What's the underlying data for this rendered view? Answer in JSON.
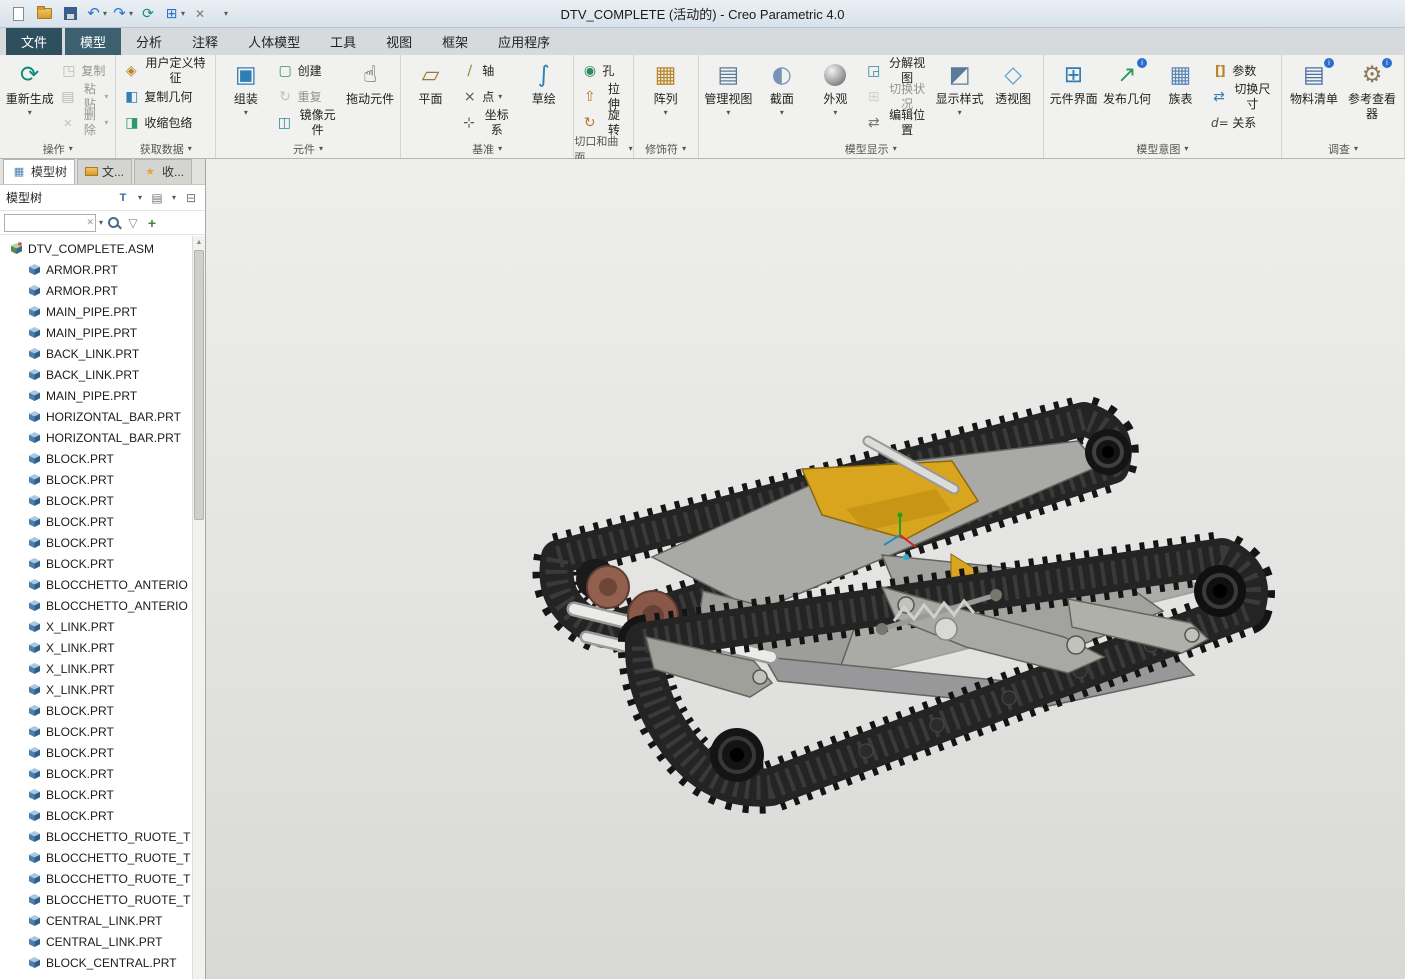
{
  "window": {
    "title": "DTV_COMPLETE (活动的) - Creo Parametric 4.0"
  },
  "quick_access": {
    "icons": [
      "new-file",
      "open",
      "save",
      "undo",
      "redo",
      "regenerate",
      "windows",
      "close-window",
      "customize"
    ]
  },
  "ribbon": {
    "tabs": [
      "文件",
      "模型",
      "分析",
      "注释",
      "人体模型",
      "工具",
      "视图",
      "框架",
      "应用程序"
    ],
    "active_tab": "模型",
    "groups": {
      "operations": {
        "label": "操作",
        "buttons": {
          "regenerate": "重新生成",
          "copy": "复制",
          "paste": "粘贴",
          "delete": "删除"
        }
      },
      "get_data": {
        "label": "获取数据",
        "buttons": {
          "udf": "用户定义特征",
          "copy_geometry": "复制几何",
          "shrinkwrap": "收缩包络"
        }
      },
      "component": {
        "label": "元件",
        "buttons": {
          "assemble": "组装",
          "create": "创建",
          "repeat": "重复",
          "mirror": "镜像元件",
          "drag": "拖动元件"
        }
      },
      "datum": {
        "label": "基准",
        "buttons": {
          "plane": "平面",
          "axis": "轴",
          "point": "点",
          "csys": "坐标系",
          "sketch": "草绘"
        }
      },
      "cut_surface": {
        "label": "切口和曲面",
        "buttons": {
          "hole": "孔",
          "extrude": "拉伸",
          "revolve": "旋转"
        }
      },
      "modifiers": {
        "label": "修饰符",
        "buttons": {
          "pattern": "阵列"
        }
      },
      "model_display": {
        "label": "模型显示",
        "buttons": {
          "manage_views": "管理视图",
          "section": "截面",
          "appearance": "外观",
          "exploded_view": "分解视图",
          "switch_state": "切换状况",
          "edit_position": "编辑位置",
          "display_style": "显示样式",
          "perspective": "透视图"
        }
      },
      "model_intent": {
        "label": "模型意图",
        "buttons": {
          "component_interface": "元件界面",
          "publish_geometry": "发布几何",
          "family_table": "族表",
          "parameters": "参数",
          "switch_dimensions": "切换尺寸",
          "relations": "关系"
        }
      },
      "investigate": {
        "label": "调查",
        "buttons": {
          "bom": "物料清单",
          "reference_viewer": "参考查看器"
        }
      }
    }
  },
  "tree_panel": {
    "tabs": [
      "模型树",
      "文...",
      "收..."
    ],
    "header": "模型树",
    "toolbar_icons": [
      "filter",
      "list-view",
      "settings"
    ],
    "search": {
      "value": ""
    },
    "search_icons": [
      "clear",
      "dropdown",
      "find",
      "funnel",
      "add"
    ],
    "root": "DTV_COMPLETE.ASM",
    "items": [
      "ARMOR.PRT",
      "ARMOR.PRT",
      "MAIN_PIPE.PRT",
      "MAIN_PIPE.PRT",
      "BACK_LINK.PRT",
      "BACK_LINK.PRT",
      "MAIN_PIPE.PRT",
      "HORIZONTAL_BAR.PRT",
      "HORIZONTAL_BAR.PRT",
      "BLOCK.PRT",
      "BLOCK.PRT",
      "BLOCK.PRT",
      "BLOCK.PRT",
      "BLOCK.PRT",
      "BLOCK.PRT",
      "BLOCCHETTO_ANTERIO",
      "BLOCCHETTO_ANTERIO",
      "X_LINK.PRT",
      "X_LINK.PRT",
      "X_LINK.PRT",
      "X_LINK.PRT",
      "BLOCK.PRT",
      "BLOCK.PRT",
      "BLOCK.PRT",
      "BLOCK.PRT",
      "BLOCK.PRT",
      "BLOCK.PRT",
      "BLOCCHETTO_RUOTE_T",
      "BLOCCHETTO_RUOTE_T",
      "BLOCCHETTO_RUOTE_T",
      "BLOCCHETTO_RUOTE_T",
      "CENTRAL_LINK.PRT",
      "CENTRAL_LINK.PRT",
      "BLOCK_CENTRAL.PRT"
    ]
  },
  "viewport": {
    "model_colors": {
      "track": "#232323",
      "chassis": "#a6a6a2",
      "accent": "#d9a51e",
      "shafts": "#e9e9e7",
      "bushings": "#93604f"
    }
  }
}
